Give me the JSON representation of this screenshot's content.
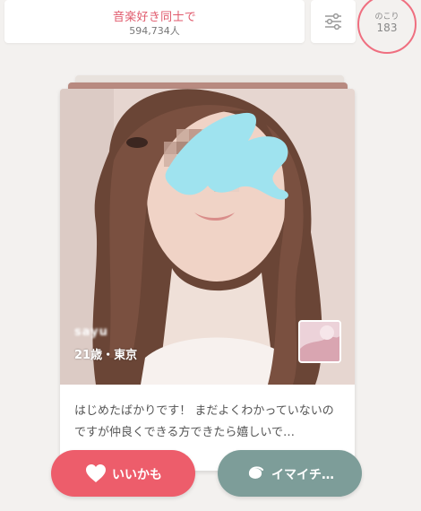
{
  "header": {
    "community_title": "音楽好き同士で",
    "member_count": "594,734人",
    "remaining_label": "のこり",
    "remaining_count": "183"
  },
  "profile": {
    "name": "sayu",
    "meta": "21歳・東京",
    "bio": "はじめたばかりです！ まだよくわかっていないのですが仲良くできる方できたら嬉しいで…"
  },
  "actions": {
    "like_label": "いいかも",
    "pass_label": "イマイチ…"
  },
  "icons": {
    "filter": "sliders-icon",
    "like": "heart-icon",
    "pass": "spiral-icon"
  },
  "colors": {
    "accent": "#ed5d6b",
    "remaining_ring": "#ef6f80",
    "pass": "#7d9d99",
    "background": "#f3f1ef"
  }
}
